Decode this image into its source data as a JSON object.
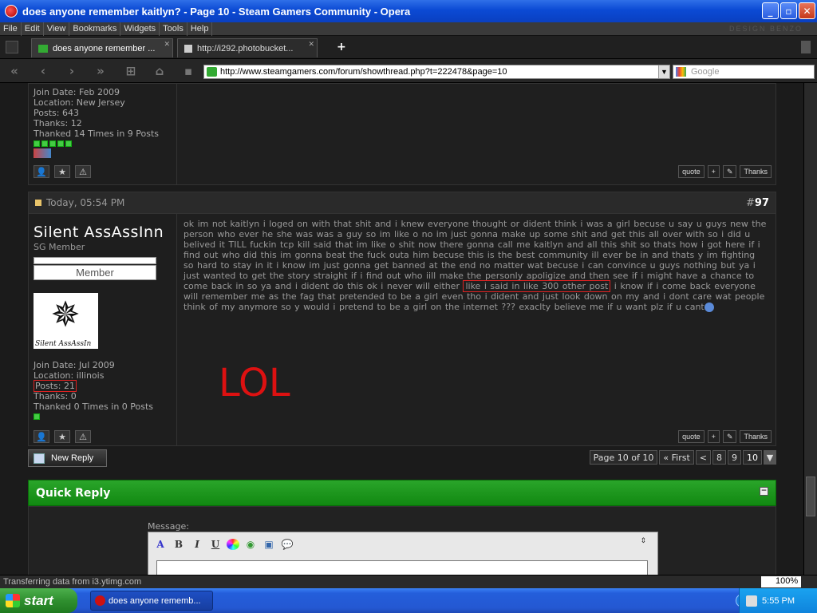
{
  "window": {
    "title": "does anyone remember kaitlyn? - Page 10 - Steam Gamers Community - Opera"
  },
  "menu": {
    "file": "File",
    "edit": "Edit",
    "view": "View",
    "bookmarks": "Bookmarks",
    "widgets": "Widgets",
    "tools": "Tools",
    "help": "Help",
    "brand": "DESIGN BENZO"
  },
  "tabs": [
    {
      "label": "does anyone remember ..."
    },
    {
      "label": "http://i292.photobucket..."
    }
  ],
  "nav": {
    "url": "http://www.steamgamers.com/forum/showthread.php?t=222478&page=10",
    "search_placeholder": "Google"
  },
  "post1": {
    "join_date": "Join Date: Feb 2009",
    "location": "Location: New Jersey",
    "posts": "Posts: 643",
    "thanks": "Thanks: 12",
    "thanked": "Thanked 14 Times in 9 Posts"
  },
  "post_buttons": {
    "quote": "quote",
    "thanks": "Thanks"
  },
  "post2": {
    "time": "Today, 05:54 PM",
    "number_prefix": "#",
    "number": "97",
    "username": "Silent AssAssInn",
    "usertitle": "SG Member",
    "rank": "Member",
    "avatar_caption": "Silent AssAssIn",
    "join_date": "Join Date: Jul 2009",
    "location": "Location: illinois",
    "posts": "Posts: 21",
    "thanks": "Thanks: 0",
    "thanked": "Thanked 0 Times in 0 Posts",
    "message_a": "ok im not kaitlyn i loged on with that shit and i knew everyone thought or dident think i was a girl becuse u say u guys new the person who ever he she was was a guy so im like o no im just gonna make up some shit and get this all over with so i did u belived it TILL fuckin tcp kill said that im like o shit now there gonna call me kaitlyn and all this shit so thats how i got here if i find out who did this im gonna beat the fuck outa him becuse this is the best community ill ever be in and thats y im fighting so hard to stay in it i know im just gonna get banned at the end no matter wat becuse i can convince u guys nothing but ya i just wanted to get the story straight if i find out who iill make the personly apoligize and then see if i might have a chance to come back in so ya and i dident do this ok i never will either ",
    "message_highlight": "like i said in like 300 other post",
    "message_b": " i know if i come back everyone will remember me as the fag that pretended to be a girl even tho i dident and just look down on my and i dont care wat people think of my anymore so y would i pretend to be a girl on the internet ??? exaclty believe me if u want plz if u cant",
    "annotation": "LOL"
  },
  "pagination": {
    "new_reply": "New Reply",
    "page_info": "Page 10 of 10",
    "first": "« First",
    "prev": "<",
    "p8": "8",
    "p9": "9",
    "p10": "10"
  },
  "quick_reply": {
    "title": "Quick Reply",
    "message_label": "Message:",
    "bold": "B",
    "italic": "I",
    "underline": "U"
  },
  "status": {
    "text": "Transferring data from i3.ytimg.com",
    "zoom": "100%"
  },
  "taskbar": {
    "start": "start",
    "task": "does anyone rememb...",
    "clock": "5:55 PM"
  },
  "colors": {
    "accent_green": "#118811",
    "highlight_red": "#dd2222"
  }
}
